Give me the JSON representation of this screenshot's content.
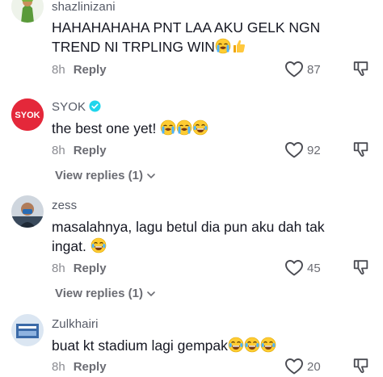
{
  "comments": [
    {
      "username": "shazlinizani",
      "text_lines": [
        "HAHAHAHAHA PNT LAA AKU GELK NGN",
        "TREND NI TRPLING WIN"
      ],
      "emoji": [
        "loudly-crying-face",
        "thumbs-up"
      ],
      "time": "8h",
      "reply_label": "Reply",
      "likes": "87",
      "verified": false
    },
    {
      "username": "SYOK",
      "avatar_text": "SYOK",
      "text_lines": [
        "the best one yet!"
      ],
      "emoji": [
        "loudly-crying-face",
        "loudly-crying-face",
        "face-with-tears-of-joy"
      ],
      "time": "8h",
      "reply_label": "Reply",
      "likes": "92",
      "verified": true,
      "view_replies": "View replies (1)"
    },
    {
      "username": "zess",
      "text_lines": [
        "masalahnya, lagu betul dia pun aku dah tak",
        "ingat."
      ],
      "emoji": [
        "face-with-tears-of-joy"
      ],
      "time": "8h",
      "reply_label": "Reply",
      "likes": "45",
      "verified": false,
      "view_replies": "View replies (1)"
    },
    {
      "username": "Zulkhairi",
      "text_lines": [
        "buat kt stadium lagi gempak"
      ],
      "emoji": [
        "face-with-tears-of-joy",
        "face-with-tears-of-joy",
        "face-with-tears-of-joy"
      ],
      "time": "8h",
      "reply_label": "Reply",
      "likes": "20",
      "verified": false
    }
  ],
  "colors": {
    "brand_red": "#e4283a",
    "verified_blue": "#20d5ec",
    "text_primary": "#161823",
    "text_secondary": "#8a8b91"
  }
}
